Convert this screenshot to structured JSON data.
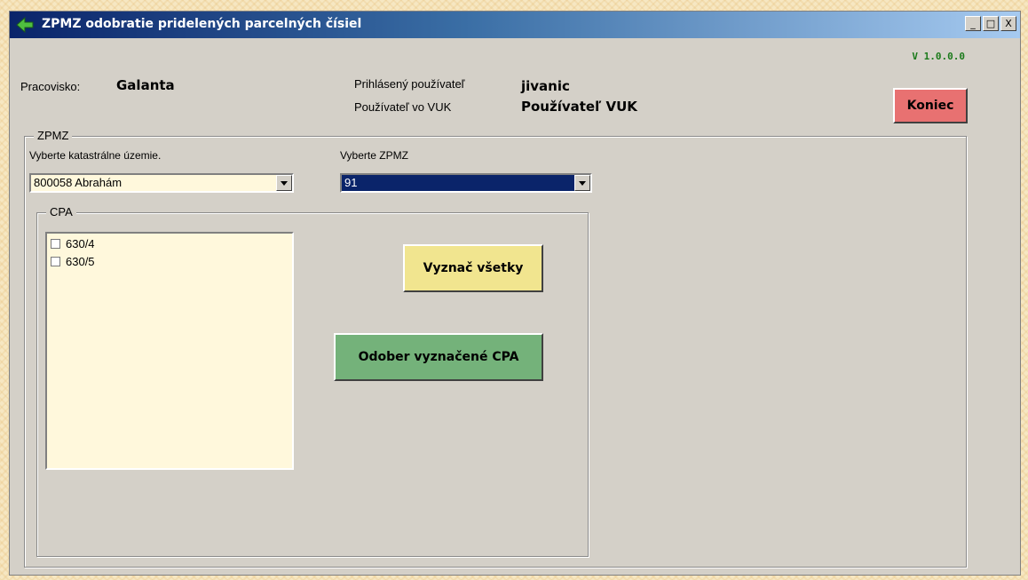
{
  "window": {
    "title": "ZPMZ odobratie pridelených parcelných čísiel",
    "minimize": "_",
    "maximize": "□",
    "close": "X",
    "version": "V 1.0.0.0"
  },
  "header": {
    "workplace_label": "Pracovisko:",
    "workplace_value": "Galanta",
    "user_label": "Prihlásený používateľ",
    "user_value": "jivanic",
    "vuk_label": "Používateľ vo VUK",
    "vuk_value": "Používateľ VUK",
    "exit_button": "Koniec"
  },
  "zpmz": {
    "group_title": "ZPMZ",
    "cadastral_label": "Vyberte katastrálne územie.",
    "cadastral_value": "800058 Abrahám",
    "zpmz_label": "Vyberte ZPMZ",
    "zpmz_value": "91"
  },
  "cpa": {
    "group_title": "CPA",
    "items": [
      {
        "label": "630/4",
        "checked": false
      },
      {
        "label": "630/5",
        "checked": false
      }
    ],
    "select_all_button": "Vyznač všetky",
    "remove_button": "Odober vyznačené CPA"
  },
  "colors": {
    "title_gradient_start": "#0a246a",
    "exit_button": "#e87171",
    "select_all_button": "#f1e58f",
    "remove_button": "#74b27a",
    "selected_combo": "#0a246a"
  }
}
